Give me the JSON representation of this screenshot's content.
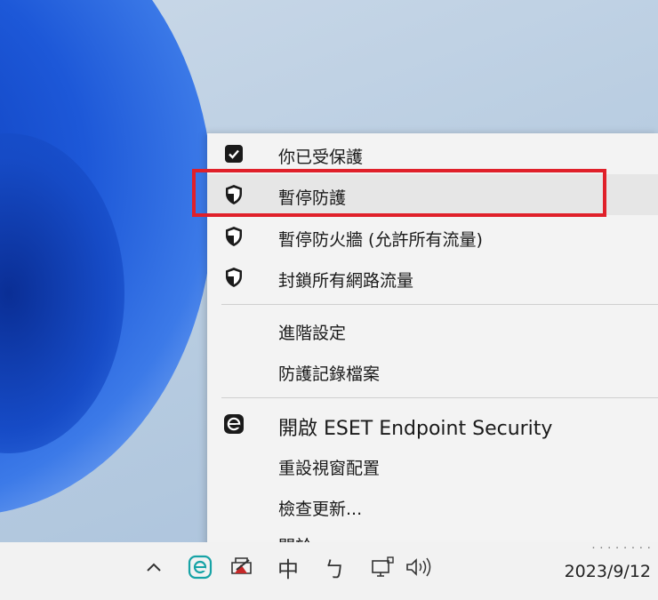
{
  "menu": {
    "items": [
      {
        "label": "你已受保護",
        "icon": "checkmark-square-icon"
      },
      {
        "label": "暫停防護",
        "icon": "shield-icon"
      },
      {
        "label": "暫停防火牆 (允許所有流量)",
        "icon": "shield-icon"
      },
      {
        "label": "封鎖所有網路流量",
        "icon": "shield-icon"
      },
      {
        "label": "進階設定",
        "icon": ""
      },
      {
        "label": "防護記錄檔案",
        "icon": ""
      },
      {
        "label": "開啟 ESET Endpoint Security",
        "icon": "eset-e-icon"
      },
      {
        "label": "重設視窗配置",
        "icon": ""
      },
      {
        "label": "檢查更新...",
        "icon": ""
      },
      {
        "label": "關於",
        "icon": ""
      }
    ]
  },
  "taskbar": {
    "icons": [
      "chevron-up-icon",
      "eset-tray-icon",
      "printer-warning-icon",
      "ime-icon",
      "ime-mode-icon",
      "network-icon",
      "speaker-icon"
    ],
    "ime_label": "中",
    "ime_mode_label": "ㄅ",
    "date": "2023/9/12"
  },
  "colors": {
    "highlight_border": "#e0202a",
    "eset_teal": "#17a3a6",
    "menu_bg": "#f3f3f3"
  }
}
